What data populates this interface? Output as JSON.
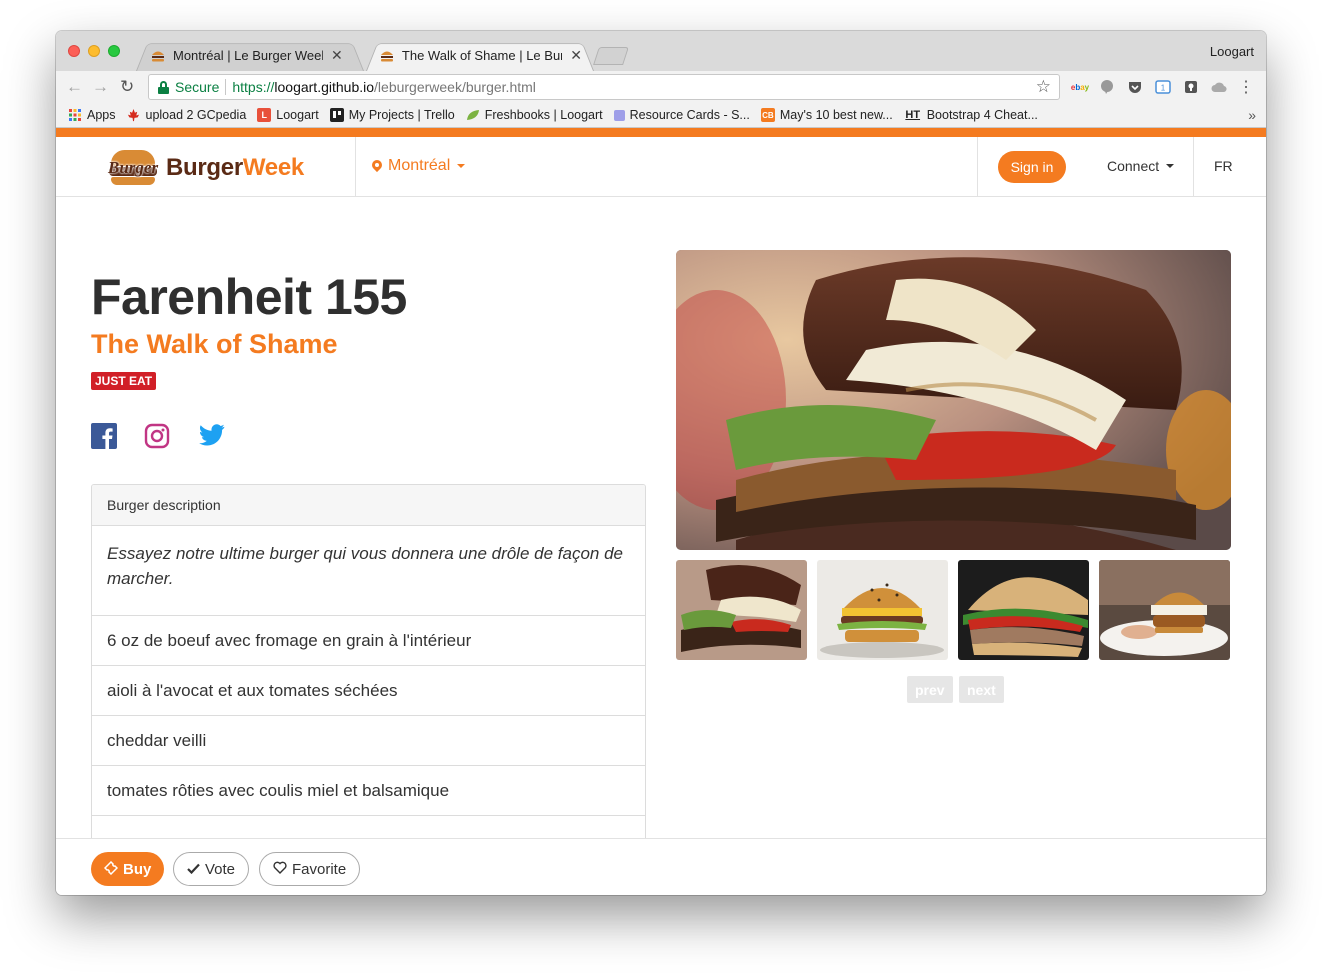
{
  "browser": {
    "profile_name": "Loogart",
    "tabs": [
      {
        "title": "Montréal | Le Burger Week",
        "active": false
      },
      {
        "title": "The Walk of Shame | Le Burger Week",
        "active": true
      }
    ],
    "omnibox": {
      "secure_label": "Secure",
      "url_scheme": "https://",
      "url_host": "loogart.github.io",
      "url_path": "/leburgerweek/burger.html"
    },
    "bookmarks": [
      {
        "label": "Apps",
        "icon": "apps-grid-icon"
      },
      {
        "label": "upload 2 GCpedia",
        "icon": "maple-leaf-icon"
      },
      {
        "label": "Loogart",
        "icon": "loogart-icon"
      },
      {
        "label": "My Projects | Trello",
        "icon": "trello-icon"
      },
      {
        "label": "Freshbooks | Loogart",
        "icon": "freshbooks-leaf-icon"
      },
      {
        "label": "Resource Cards - S...",
        "icon": "resource-cards-icon"
      },
      {
        "label": "May's 10 best new...",
        "icon": "cb-icon"
      },
      {
        "label": "Bootstrap 4 Cheat...",
        "icon": "ht-icon"
      }
    ]
  },
  "site": {
    "brand_word_1": "Burger",
    "brand_word_2": "Week",
    "logo_script": "Burger",
    "city": "Montréal",
    "sign_in": "Sign in",
    "connect": "Connect",
    "language": "FR",
    "accent_color": "#f47b20"
  },
  "burger": {
    "restaurant": "Farenheit 155",
    "name": "The Walk of Shame",
    "badge": "JUST EAT",
    "panel_title": "Burger description",
    "description": "Essayez notre ultime burger qui vous donnera une drôle de façon de marcher.",
    "ingredients": [
      "6 oz de boeuf avec fromage en grain à l'intérieur",
      "aioli à l'avocat et aux tomates séchées",
      "cheddar veilli",
      "tomates rôties avec coulis miel et balsamique"
    ]
  },
  "gallery": {
    "prev": "prev",
    "next": "next"
  },
  "actions": {
    "buy": "Buy",
    "vote": "Vote",
    "favorite": "Favorite"
  }
}
